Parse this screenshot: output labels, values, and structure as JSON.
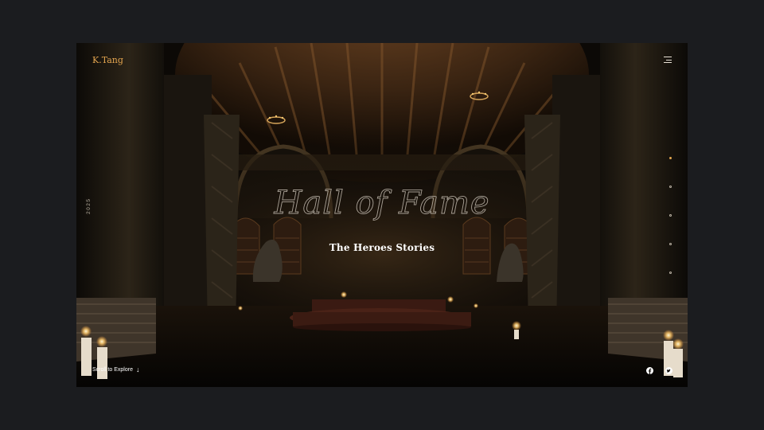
{
  "header": {
    "brand": "K.Tang",
    "menu_icon": "hamburger-menu-icon"
  },
  "side": {
    "year": "2025"
  },
  "slider": {
    "count": 5,
    "active_index": 0
  },
  "hero": {
    "title": "Hall of Fame",
    "subtitle": "The Heroes Stories"
  },
  "footer": {
    "scroll_label": "Scroll to Explore",
    "scroll_icon": "arrow-down-icon",
    "social": [
      "facebook-icon",
      "twitter-icon"
    ]
  },
  "colors": {
    "accent": "#e3a54f",
    "page_bg": "#1b1c1f",
    "text": "#ffffff"
  }
}
